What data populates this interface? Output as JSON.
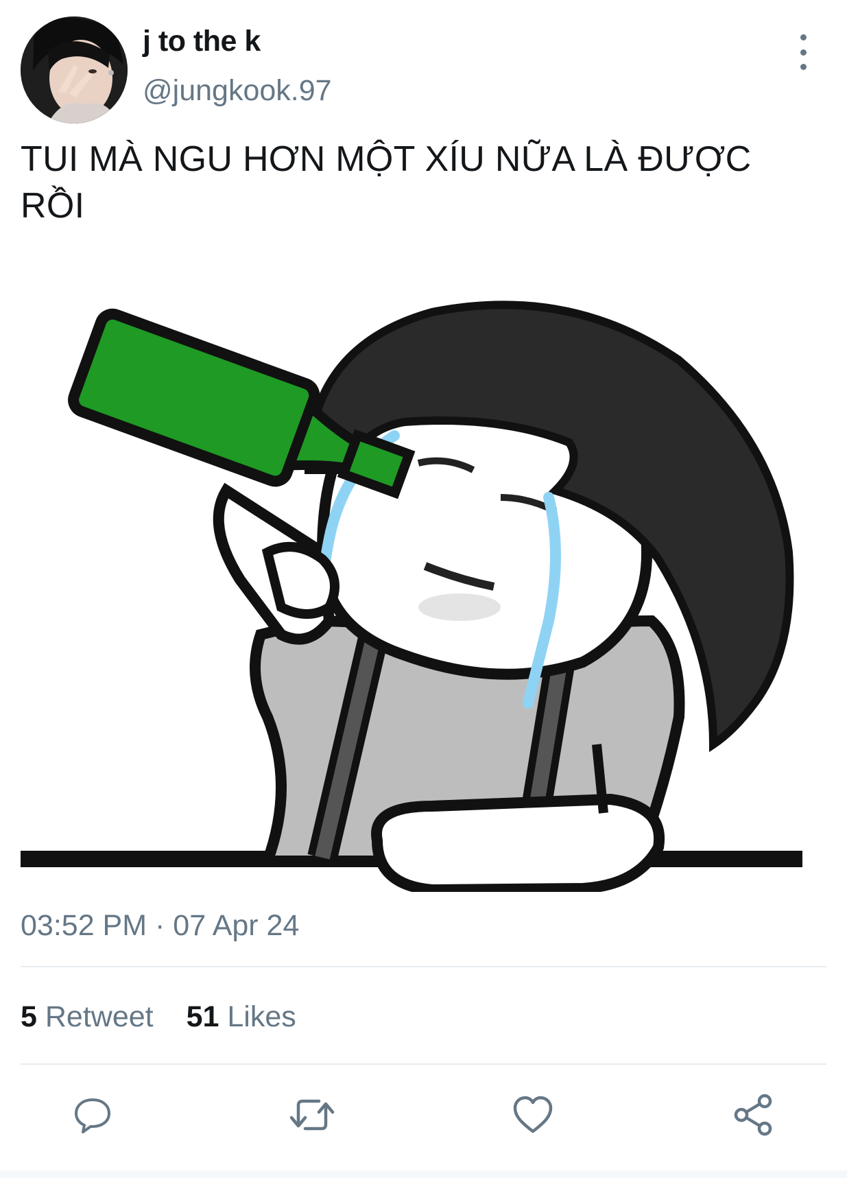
{
  "user": {
    "display_name": "j to the k",
    "handle": "@jungkook.97"
  },
  "tweet": {
    "text_line1": "TUI MÀ NGU HƠN MỘT XÍU NỮA LÀ ĐƯỢC",
    "text_line2": "RỒI",
    "time": "03:52 PM",
    "separator": "·",
    "date": "07 Apr 24"
  },
  "stats": {
    "retweets_count": "5",
    "retweets_label": "Retweet",
    "likes_count": "51",
    "likes_label": "Likes"
  },
  "actions": {
    "reply_icon": "comment-icon",
    "retweet_icon": "retweet-icon",
    "like_icon": "heart-icon",
    "share_icon": "share-icon"
  },
  "colors": {
    "secondary_text": "#657786",
    "bottle_green": "#1f9a24",
    "tears": "#8fd3f4"
  }
}
